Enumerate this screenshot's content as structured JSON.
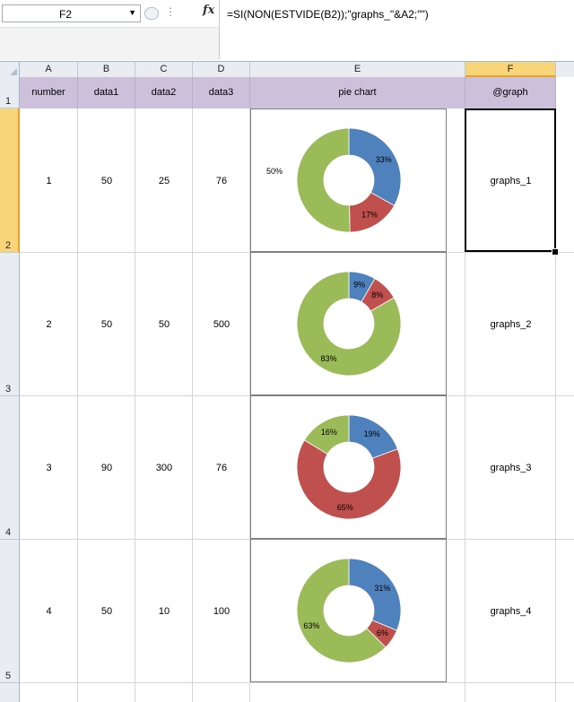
{
  "formula_bar": {
    "name_box": "F2",
    "fx_label": "fx",
    "formula": "=SI(NON(ESTVIDE(B2));\"graphs_\"&A2;\"\")"
  },
  "columns": [
    "A",
    "B",
    "C",
    "D",
    "E",
    "F"
  ],
  "rows_labels": [
    "1",
    "2",
    "3",
    "4",
    "5"
  ],
  "header": {
    "number": "number",
    "data1": "data1",
    "data2": "data2",
    "data3": "data3",
    "pie_chart": "pie chart",
    "graph": "@graph"
  },
  "rows": [
    {
      "number": "1",
      "data1": "50",
      "data2": "25",
      "data3": "76",
      "graph": "graphs_1"
    },
    {
      "number": "2",
      "data1": "50",
      "data2": "50",
      "data3": "500",
      "graph": "graphs_2"
    },
    {
      "number": "3",
      "data1": "90",
      "data2": "300",
      "data3": "76",
      "graph": "graphs_3"
    },
    {
      "number": "4",
      "data1": "50",
      "data2": "10",
      "data3": "100",
      "graph": "graphs_4"
    }
  ],
  "colors": {
    "blue": "#4f81bd",
    "red": "#c0504d",
    "green": "#9bbb59",
    "header_fill": "#ccc0da",
    "selected_header": "#f9d57a"
  },
  "chart_data": [
    {
      "type": "pie",
      "donut": true,
      "categories": [
        "data1",
        "data2",
        "data3"
      ],
      "values": [
        50,
        25,
        76
      ],
      "labels": [
        "33%",
        "17%",
        "50%"
      ]
    },
    {
      "type": "pie",
      "donut": true,
      "categories": [
        "data1",
        "data2",
        "data3"
      ],
      "values": [
        50,
        50,
        500
      ],
      "labels": [
        "9%",
        "8%",
        "83%"
      ]
    },
    {
      "type": "pie",
      "donut": true,
      "categories": [
        "data1",
        "data2",
        "data3"
      ],
      "values": [
        90,
        300,
        76
      ],
      "labels": [
        "19%",
        "65%",
        "16%"
      ]
    },
    {
      "type": "pie",
      "donut": true,
      "categories": [
        "data1",
        "data2",
        "data3"
      ],
      "values": [
        50,
        10,
        100
      ],
      "labels": [
        "31%",
        "6%",
        "63%"
      ]
    }
  ]
}
